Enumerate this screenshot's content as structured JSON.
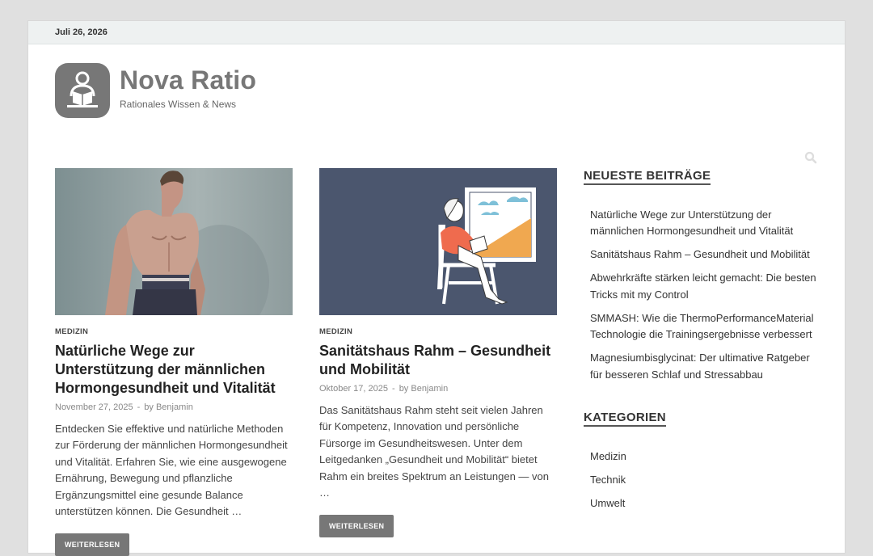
{
  "topbar": {
    "date": "Juli 26, 2026"
  },
  "header": {
    "title": "Nova Ratio",
    "tagline": "Rationales Wissen & News"
  },
  "posts": [
    {
      "category": "MEDIZIN",
      "title": "Natürliche Wege zur Unterstützung der männlichen Hormongesundheit und Vitalität",
      "date": "November 27, 2025",
      "sep": "-",
      "author": "by Benjamin",
      "excerpt": "Entdecken Sie effektive und natürliche Methoden zur Förderung der männlichen Hormongesundheit und Vitalität. Erfahren Sie, wie eine ausgewogene Ernährung, Bewegung und pflanzliche Ergänzungsmittel eine gesunde Balance unterstützen können. Die Gesundheit …",
      "button": "WEITERLESEN"
    },
    {
      "category": "MEDIZIN",
      "title": "Sanitätshaus Rahm – Gesundheit und Mobilität",
      "date": "Oktober 17, 2025",
      "sep": "-",
      "author": "by Benjamin",
      "excerpt": "Das Sanitätshaus Rahm steht seit vielen Jahren für Kompetenz, Innovation und persönliche Fürsorge im Gesundheitswesen. Unter dem Leitgedanken „Gesundheit und Mobilität“ bietet Rahm ein breites Spektrum an Leistungen — von …",
      "button": "WEITERLESEN"
    }
  ],
  "sidebar": {
    "recent_title": "NEUESTE BEITRÄGE",
    "recent": [
      "Natürliche Wege zur Unterstützung der männlichen Hormongesundheit und Vitalität",
      "Sanitätshaus Rahm – Gesundheit und Mobilität",
      "Abwehrkräfte stärken leicht gemacht: Die besten Tricks mit my Control",
      "SMMASH: Wie die ThermoPerformanceMaterial Technologie die Trainingsergebnisse verbessert",
      "Magnesiumbisglycinat: Der ultimative Ratgeber für besseren Schlaf und Stressabbau"
    ],
    "categories_title": "KATEGORIEN",
    "categories": [
      "Medizin",
      "Technik",
      "Umwelt"
    ]
  },
  "colors": {
    "accent": "#777777",
    "topbar": "#eef1f1",
    "illustration_bg": "#4b566e"
  },
  "icons": {
    "logo": "reader-icon",
    "search": "search-icon"
  }
}
